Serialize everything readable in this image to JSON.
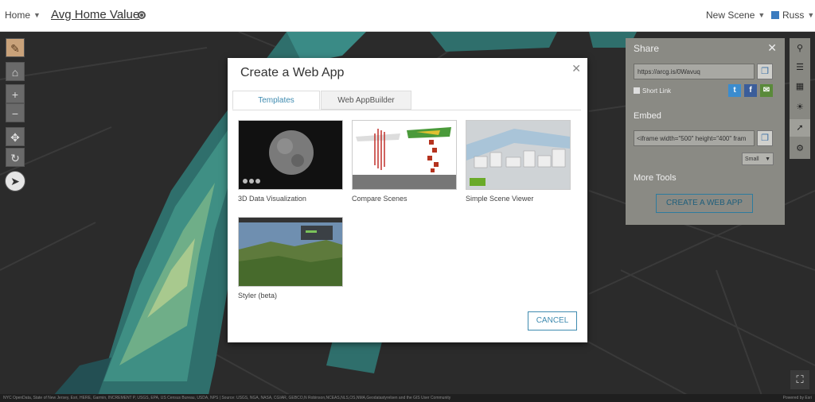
{
  "header": {
    "home_label": "Home",
    "app_title": "Avg Home Value",
    "new_scene_label": "New Scene",
    "user_label": "Russ"
  },
  "left_toolbar": {
    "icons": [
      "edit-icon",
      "home-icon",
      "zoom-in-icon",
      "zoom-out-icon",
      "pan-icon",
      "rotate-icon",
      "compass-icon"
    ],
    "zoom_in": "+",
    "zoom_out": "−"
  },
  "share_panel": {
    "title": "Share",
    "link_value": "https://arcg.is/0Wavuq",
    "short_link_label": "Short Link",
    "embed_title": "Embed",
    "embed_code": "<iframe width=\"500\" height=\"400\" fram",
    "size_value": "Small",
    "more_tools_title": "More Tools",
    "create_button": "CREATE A WEB APP",
    "social": [
      "twitter-icon",
      "facebook-icon",
      "email-icon"
    ]
  },
  "right_toolbar": {
    "icons": [
      "search-icon",
      "layers-icon",
      "basemap-gallery-icon",
      "daylight-icon",
      "share-icon",
      "settings-icon"
    ]
  },
  "modal": {
    "title": "Create a Web App",
    "tabs": [
      "Templates",
      "Web AppBuilder"
    ],
    "templates": [
      {
        "label": "3D Data Visualization"
      },
      {
        "label": "Compare Scenes"
      },
      {
        "label": "Simple Scene Viewer"
      },
      {
        "label": "Styler (beta)"
      }
    ],
    "cancel_label": "CANCEL"
  },
  "attribution": {
    "text": "NYC OpenData, State of New Jersey, Esri, HERE, Garmin, INCREMENT P, USGS, EPA, US Census Bureau, USDA, NPS | Source: USGS, NGA, NASA, CGIAR, GEBCO,N Robinson,NCEAS,NLS,OS,NMA,Geodatastyrelsen and the GIS User Community",
    "powered": "Powered by Esri"
  },
  "colors": {
    "accent": "#3f8bb0",
    "share_panel_bg": "#8a8a84"
  }
}
